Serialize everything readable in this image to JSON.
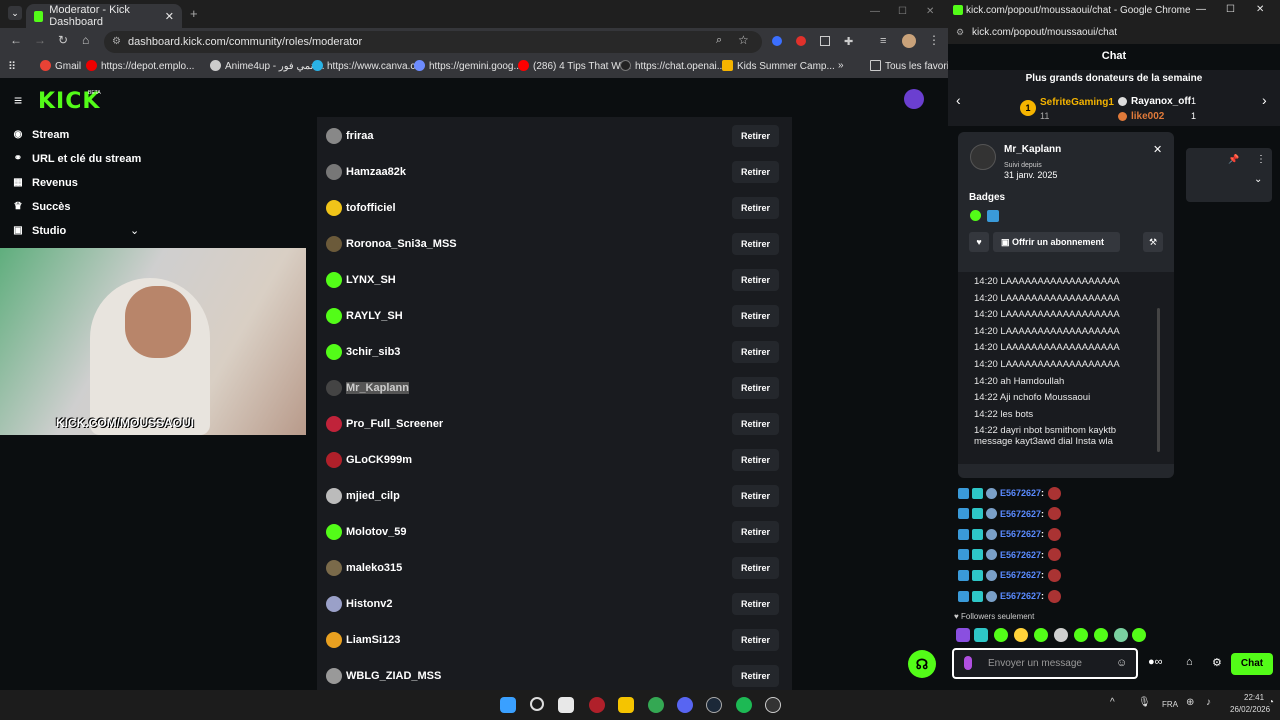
{
  "left_window": {
    "tab_title": "Moderator - Kick Dashboard",
    "url": "dashboard.kick.com/community/roles/moderator",
    "bookmarks": [
      "Gmail",
      "https://depot.emplo...",
      "Anime4up - انمي فور...",
      "https://www.canva.c...",
      "https://gemini.goog...",
      "(286) 4 Tips That Wi...",
      "https://chat.openai....",
      "Kids Summer Camp...",
      "Tous les favoris"
    ]
  },
  "sidebar": {
    "logo": "KICK",
    "beta": "BETA",
    "items": [
      {
        "label": "Stream",
        "icon": "stream-icon"
      },
      {
        "label": "URL et clé du stream",
        "icon": "link-icon"
      },
      {
        "label": "Revenus",
        "icon": "revenue-icon"
      },
      {
        "label": "Succès",
        "icon": "trophy-icon"
      },
      {
        "label": "Studio",
        "icon": "studio-icon"
      }
    ]
  },
  "webcam": {
    "overlay_text": "KICK.COM/MOUSSAOUI"
  },
  "moderators": {
    "action_label": "Retirer",
    "rows": [
      {
        "name": "friraa",
        "color": "#888888"
      },
      {
        "name": "Hamzaa82k",
        "color": "#777777"
      },
      {
        "name": "tofofficiel",
        "color": "#f0c419"
      },
      {
        "name": "Roronoa_Sni3a_MSS",
        "color": "#6b5a3a"
      },
      {
        "name": "LYNX_SH",
        "color": "#53fc18"
      },
      {
        "name": "RAYLY_SH",
        "color": "#53fc18"
      },
      {
        "name": "3chir_sib3",
        "color": "#53fc18"
      },
      {
        "name": "Mr_Kaplann",
        "color": "#444444"
      },
      {
        "name": "Pro_Full_Screener",
        "color": "#c0233a"
      },
      {
        "name": "GLoCK999m",
        "color": "#b0202a"
      },
      {
        "name": "mjied_cilp",
        "color": "#bbbbbb"
      },
      {
        "name": "Molotov_59",
        "color": "#53fc18"
      },
      {
        "name": "maleko315",
        "color": "#7a6a4a"
      },
      {
        "name": "Histonv2",
        "color": "#9aa0c8"
      },
      {
        "name": "LiamSi123",
        "color": "#e8a020"
      },
      {
        "name": "WBLG_ZIAD_MSS",
        "color": "#999999"
      }
    ]
  },
  "right_window": {
    "title": "kick.com/popout/moussaoui/chat - Google Chrome",
    "url": "kick.com/popout/moussaoui/chat",
    "chat_header": "Chat",
    "donors_title": "Plus grands donateurs de la semaine",
    "donors": [
      {
        "rank": "1",
        "name": "SefriteGaming1",
        "count": "11"
      },
      {
        "name": "Rayanox_off",
        "count": "1"
      },
      {
        "name": "like002",
        "count": "1"
      }
    ],
    "user_card": {
      "username": "Mr_Kaplann",
      "followed_label": "Suivi depuis",
      "followed_date": "31 janv. 2025",
      "badges_label": "Badges",
      "gift_button": "Offrir un abonnement",
      "log": [
        "14:20 LAAAAAAAAAAAAAAAAAA",
        "14:20 LAAAAAAAAAAAAAAAAAA",
        "14:20 LAAAAAAAAAAAAAAAAAA",
        "14:20 LAAAAAAAAAAAAAAAAAA",
        "14:20 LAAAAAAAAAAAAAAAAAA",
        "14:20 LAAAAAAAAAAAAAAAAAA",
        "14:20 ah Hamdoullah",
        "14:22 Aji nchofo Moussaoui",
        "14:22 les bots",
        "14:22 dayri nbot bsmithom kayktb",
        "message kayt3awd dial Insta wla"
      ]
    },
    "chat_messages": [
      {
        "user": "E5672627",
        "sep": ":"
      },
      {
        "user": "E5672627",
        "sep": ":"
      },
      {
        "user": "E5672627",
        "sep": ":"
      },
      {
        "user": "E5672627",
        "sep": ":"
      },
      {
        "user": "E5672627",
        "sep": ":"
      },
      {
        "user": "E5672627",
        "sep": ":"
      }
    ],
    "followers_only": "Followers seulement",
    "input_placeholder": "Envoyer un message",
    "chat_button": "Chat"
  },
  "taskbar": {
    "lang": "FRA",
    "time": "22:41",
    "date": "26/02/2026"
  },
  "colors": {
    "kick_green": "#53fc18",
    "link_blue": "#5a8bff"
  }
}
